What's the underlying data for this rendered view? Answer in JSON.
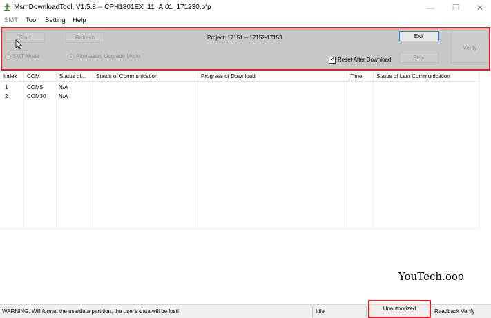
{
  "window": {
    "title": "MsmDownloadTool, V1.5.8 -- CPH1801EX_11_A.01_171230.ofp",
    "minimize_glyph": "—",
    "maximize_glyph": "☐",
    "close_glyph": "✕"
  },
  "menu": {
    "items": [
      "SMT",
      "Tool",
      "Setting",
      "Help"
    ]
  },
  "toolbar": {
    "start_label": "Start",
    "refresh_label": "Refresh",
    "project_label": "Project: 17151 -- 17152-17153",
    "exit_label": "Exit",
    "verify_label": "Verify",
    "stop_label": "Stop",
    "smt_mode_label": "SMT Mode",
    "after_sales_label": "After-sales Upgrade Mode",
    "reset_after_download_label": "Reset After Download",
    "reset_after_download_checked": true
  },
  "grid": {
    "columns": [
      "Index",
      "COM",
      "Status of...",
      "Status of Communication",
      "Progress of Download",
      "Time",
      "Status of Last Communication"
    ],
    "rows": [
      {
        "index": "1",
        "com": "COM5",
        "status": "N/A"
      },
      {
        "index": "2",
        "com": "COM30",
        "status": "N/A"
      }
    ]
  },
  "watermark": "YouTech.ooo",
  "statusbar": {
    "warning": "WARNING: Will format the userdata partition, the user's data will be lost!",
    "state": "Idle",
    "authorization": "Unauthorized",
    "readback": "Readback Verify"
  },
  "colors": {
    "highlight": "#e02020",
    "toolbar_bg": "#c8c8c8",
    "accent": "#2d7bd4"
  },
  "icons": [
    "app-icon",
    "cursor-icon",
    "check-icon"
  ]
}
